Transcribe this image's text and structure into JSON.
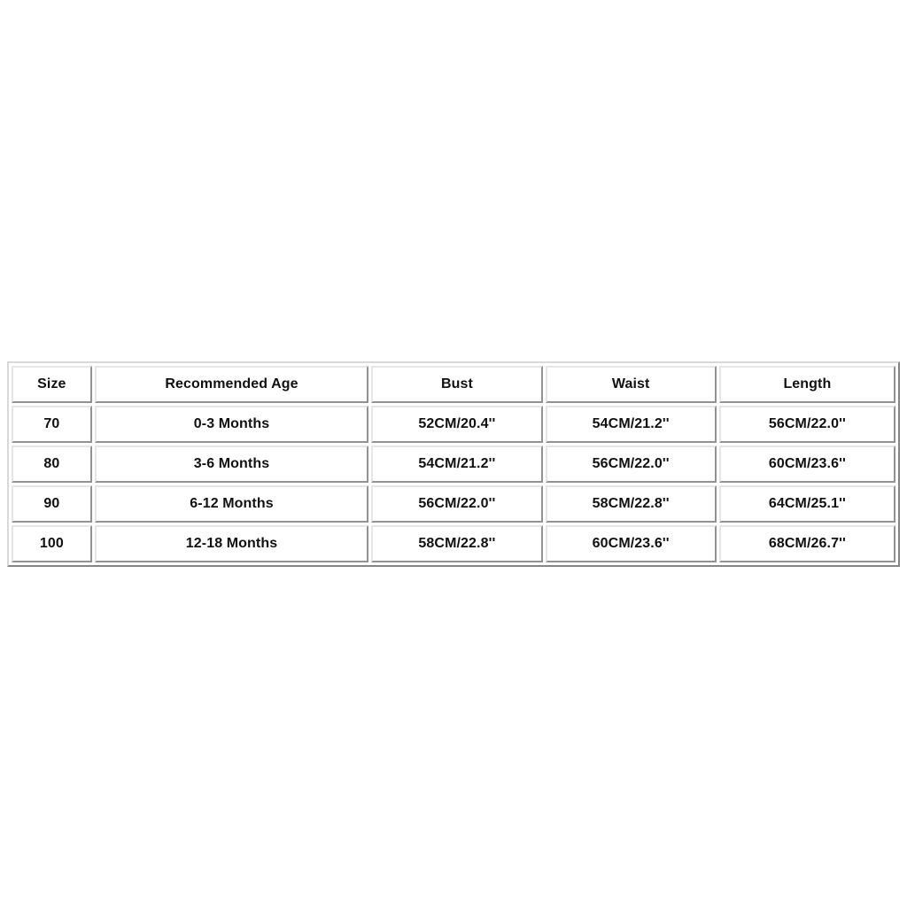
{
  "table": {
    "name": "baby-clothing-size-chart",
    "columns": [
      "Size",
      "Recommended Age",
      "Bust",
      "Waist",
      "Length"
    ],
    "rows": [
      {
        "size": "70",
        "age": "0-3 Months",
        "bust": "52CM/20.4''",
        "waist": "54CM/21.2''",
        "length": "56CM/22.0''"
      },
      {
        "size": "80",
        "age": "3-6 Months",
        "bust": "54CM/21.2''",
        "waist": "56CM/22.0''",
        "length": "60CM/23.6''"
      },
      {
        "size": "90",
        "age": "6-12 Months",
        "bust": "56CM/22.0''",
        "waist": "58CM/22.8''",
        "length": "64CM/25.1''"
      },
      {
        "size": "100",
        "age": "12-18 Months",
        "bust": "58CM/22.8''",
        "waist": "60CM/23.6''",
        "length": "68CM/26.7''"
      }
    ]
  },
  "colors": {
    "page_background": "#ffffff",
    "cell_background": "#ffffff",
    "text": "#111111",
    "border_outer": "#d9d9d9",
    "border_cell": "#e6e6e6"
  }
}
